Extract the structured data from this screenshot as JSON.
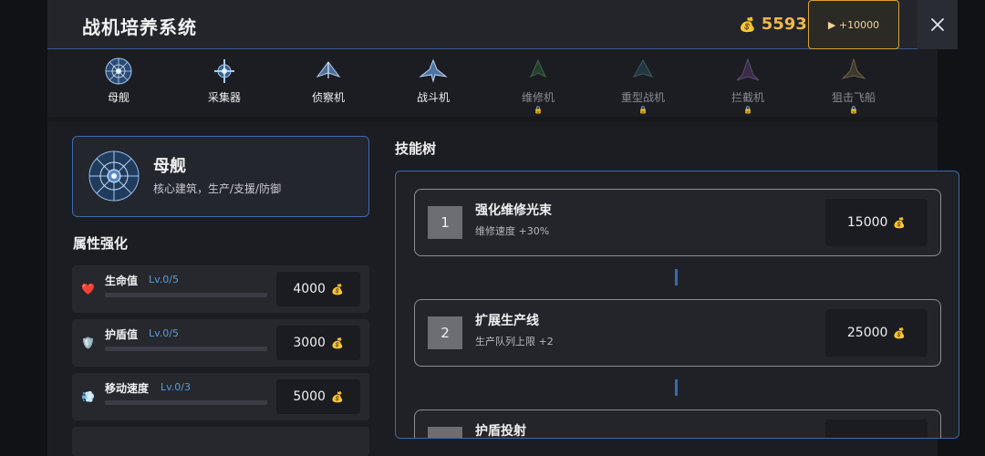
{
  "header": {
    "title": "战机培养系统",
    "coins": "5593",
    "add_coins_label": "▶ +10000"
  },
  "tabs": [
    {
      "label": "母舰",
      "locked": false
    },
    {
      "label": "采集器",
      "locked": false
    },
    {
      "label": "侦察机",
      "locked": false
    },
    {
      "label": "战斗机",
      "locked": false
    },
    {
      "label": "维修机",
      "locked": true
    },
    {
      "label": "重型战机",
      "locked": true
    },
    {
      "label": "拦截机",
      "locked": true
    },
    {
      "label": "狙击飞船",
      "locked": true
    }
  ],
  "selected": {
    "name": "母舰",
    "description": "核心建筑，生产/支援/防御"
  },
  "attributes": {
    "title": "属性强化",
    "items": [
      {
        "name": "生命值",
        "level": "Lv.0/5",
        "cost": "4000",
        "icon": "heart-icon"
      },
      {
        "name": "护盾值",
        "level": "Lv.0/5",
        "cost": "3000",
        "icon": "shield-icon"
      },
      {
        "name": "移动速度",
        "level": "Lv.0/3",
        "cost": "5000",
        "icon": "speed-icon"
      }
    ]
  },
  "skill_tree": {
    "title": "技能树",
    "skills": [
      {
        "num": "1",
        "name": "强化维修光束",
        "desc": "维修速度 +30%",
        "cost": "15000"
      },
      {
        "num": "2",
        "name": "扩展生产线",
        "desc": "生产队列上限 +2",
        "cost": "25000"
      },
      {
        "num": "",
        "name": "护盾投射",
        "desc": "",
        "cost": ""
      }
    ]
  },
  "colors": {
    "accent_blue": "#3f6aa8",
    "gold": "#f0b84a",
    "level_blue": "#5a9be0"
  }
}
